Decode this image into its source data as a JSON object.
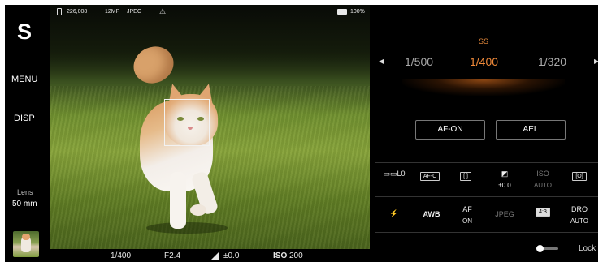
{
  "left": {
    "mode": "S",
    "menu": "MENU",
    "disp": "DISP",
    "lens_label": "Lens",
    "lens_value": "50 mm"
  },
  "status": {
    "shots": "226,008",
    "image_size": "12MP",
    "format": "JPEG",
    "battery": "100%"
  },
  "readout": {
    "shutter": "1/400",
    "aperture": "F2.4",
    "ev": "±0.0",
    "iso_label": "ISO",
    "iso": "200"
  },
  "shutter_dial": {
    "param": "SS",
    "prev": "1/500",
    "current": "1/400",
    "next": "1/320"
  },
  "buttons": {
    "af_on": "AF-ON",
    "ael": "AEL"
  },
  "fn_grid": {
    "drive": "L0",
    "focus_mode": "AF-C",
    "focus_area": "[ ]",
    "ev_value": "±0.0",
    "iso_label": "ISO",
    "iso_value": "AUTO",
    "metering": "[O]",
    "flash": "⚡",
    "wb": "AWB",
    "face_eye_1": "AF",
    "face_eye_2": "ON",
    "quality": "JPEG",
    "aspect": "4:3",
    "dro_1": "DRO",
    "dro_2": "AUTO"
  },
  "lock": {
    "label": "Lock"
  },
  "colors": {
    "accent": "#f08a3a",
    "background": "#000000"
  }
}
